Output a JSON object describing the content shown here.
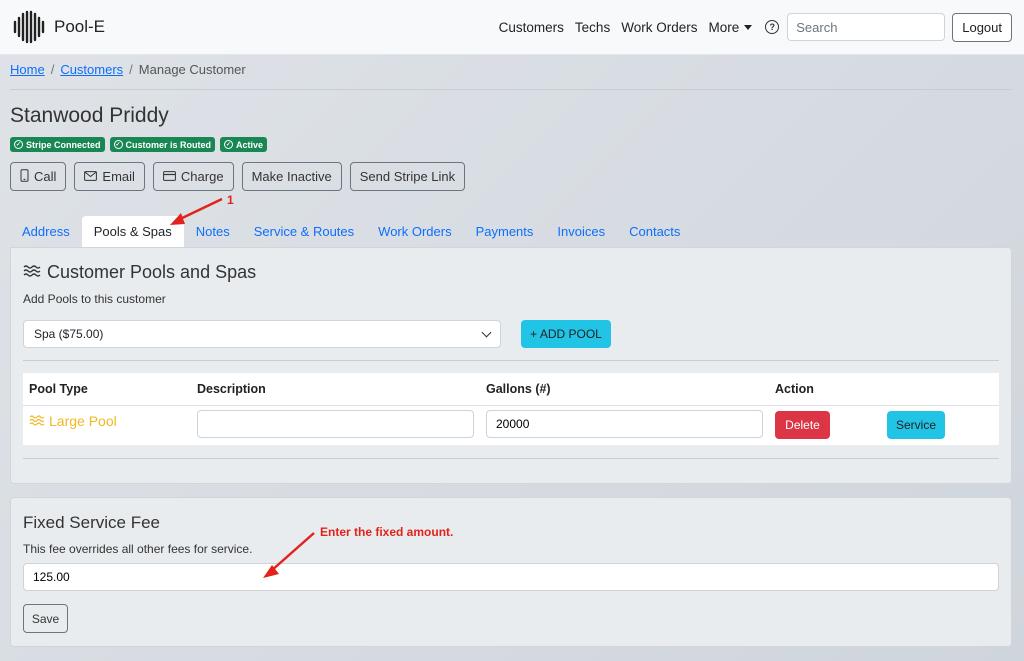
{
  "app": {
    "brand": "Pool-E"
  },
  "nav": {
    "items": [
      "Customers",
      "Techs",
      "Work Orders"
    ],
    "more_label": "More",
    "help_icon": "?",
    "search_placeholder": "Search",
    "logout_label": "Logout"
  },
  "breadcrumb": {
    "home": "Home",
    "customers": "Customers",
    "current": "Manage Customer",
    "sep": "/"
  },
  "customer": {
    "name": "Stanwood Priddy",
    "badges": [
      "Stripe Connected",
      "Customer is Routed",
      "Active"
    ]
  },
  "actions": {
    "call": "Call",
    "email": "Email",
    "charge": "Charge",
    "inactive": "Make Inactive",
    "stripe_link": "Send Stripe Link"
  },
  "tabs": [
    "Address",
    "Pools & Spas",
    "Notes",
    "Service & Routes",
    "Work Orders",
    "Payments",
    "Invoices",
    "Contacts"
  ],
  "active_tab": "Pools & Spas",
  "pools_panel": {
    "title": "Customer Pools and Spas",
    "subtitle": "Add Pools to this customer",
    "select_value": "Spa ($75.00)",
    "add_button": "+ ADD POOL",
    "columns": [
      "Pool Type",
      "Description",
      "Gallons (#)",
      "Action"
    ],
    "rows": [
      {
        "type": "Large Pool",
        "description": "",
        "gallons": "20000",
        "delete_label": "Delete",
        "service_label": "Service"
      }
    ]
  },
  "fee_panel": {
    "title": "Fixed Service Fee",
    "subtitle": "This fee overrides all other fees for service.",
    "value": "125.00",
    "save_label": "Save"
  },
  "annotations": {
    "step1": "1",
    "fixed_amount": "Enter the fixed amount."
  },
  "colors": {
    "primary": "#0d6efd",
    "success": "#198754",
    "info": "#22c4e6",
    "danger": "#dc3545",
    "pool": "#f0b823",
    "annotation": "#e3231b"
  }
}
